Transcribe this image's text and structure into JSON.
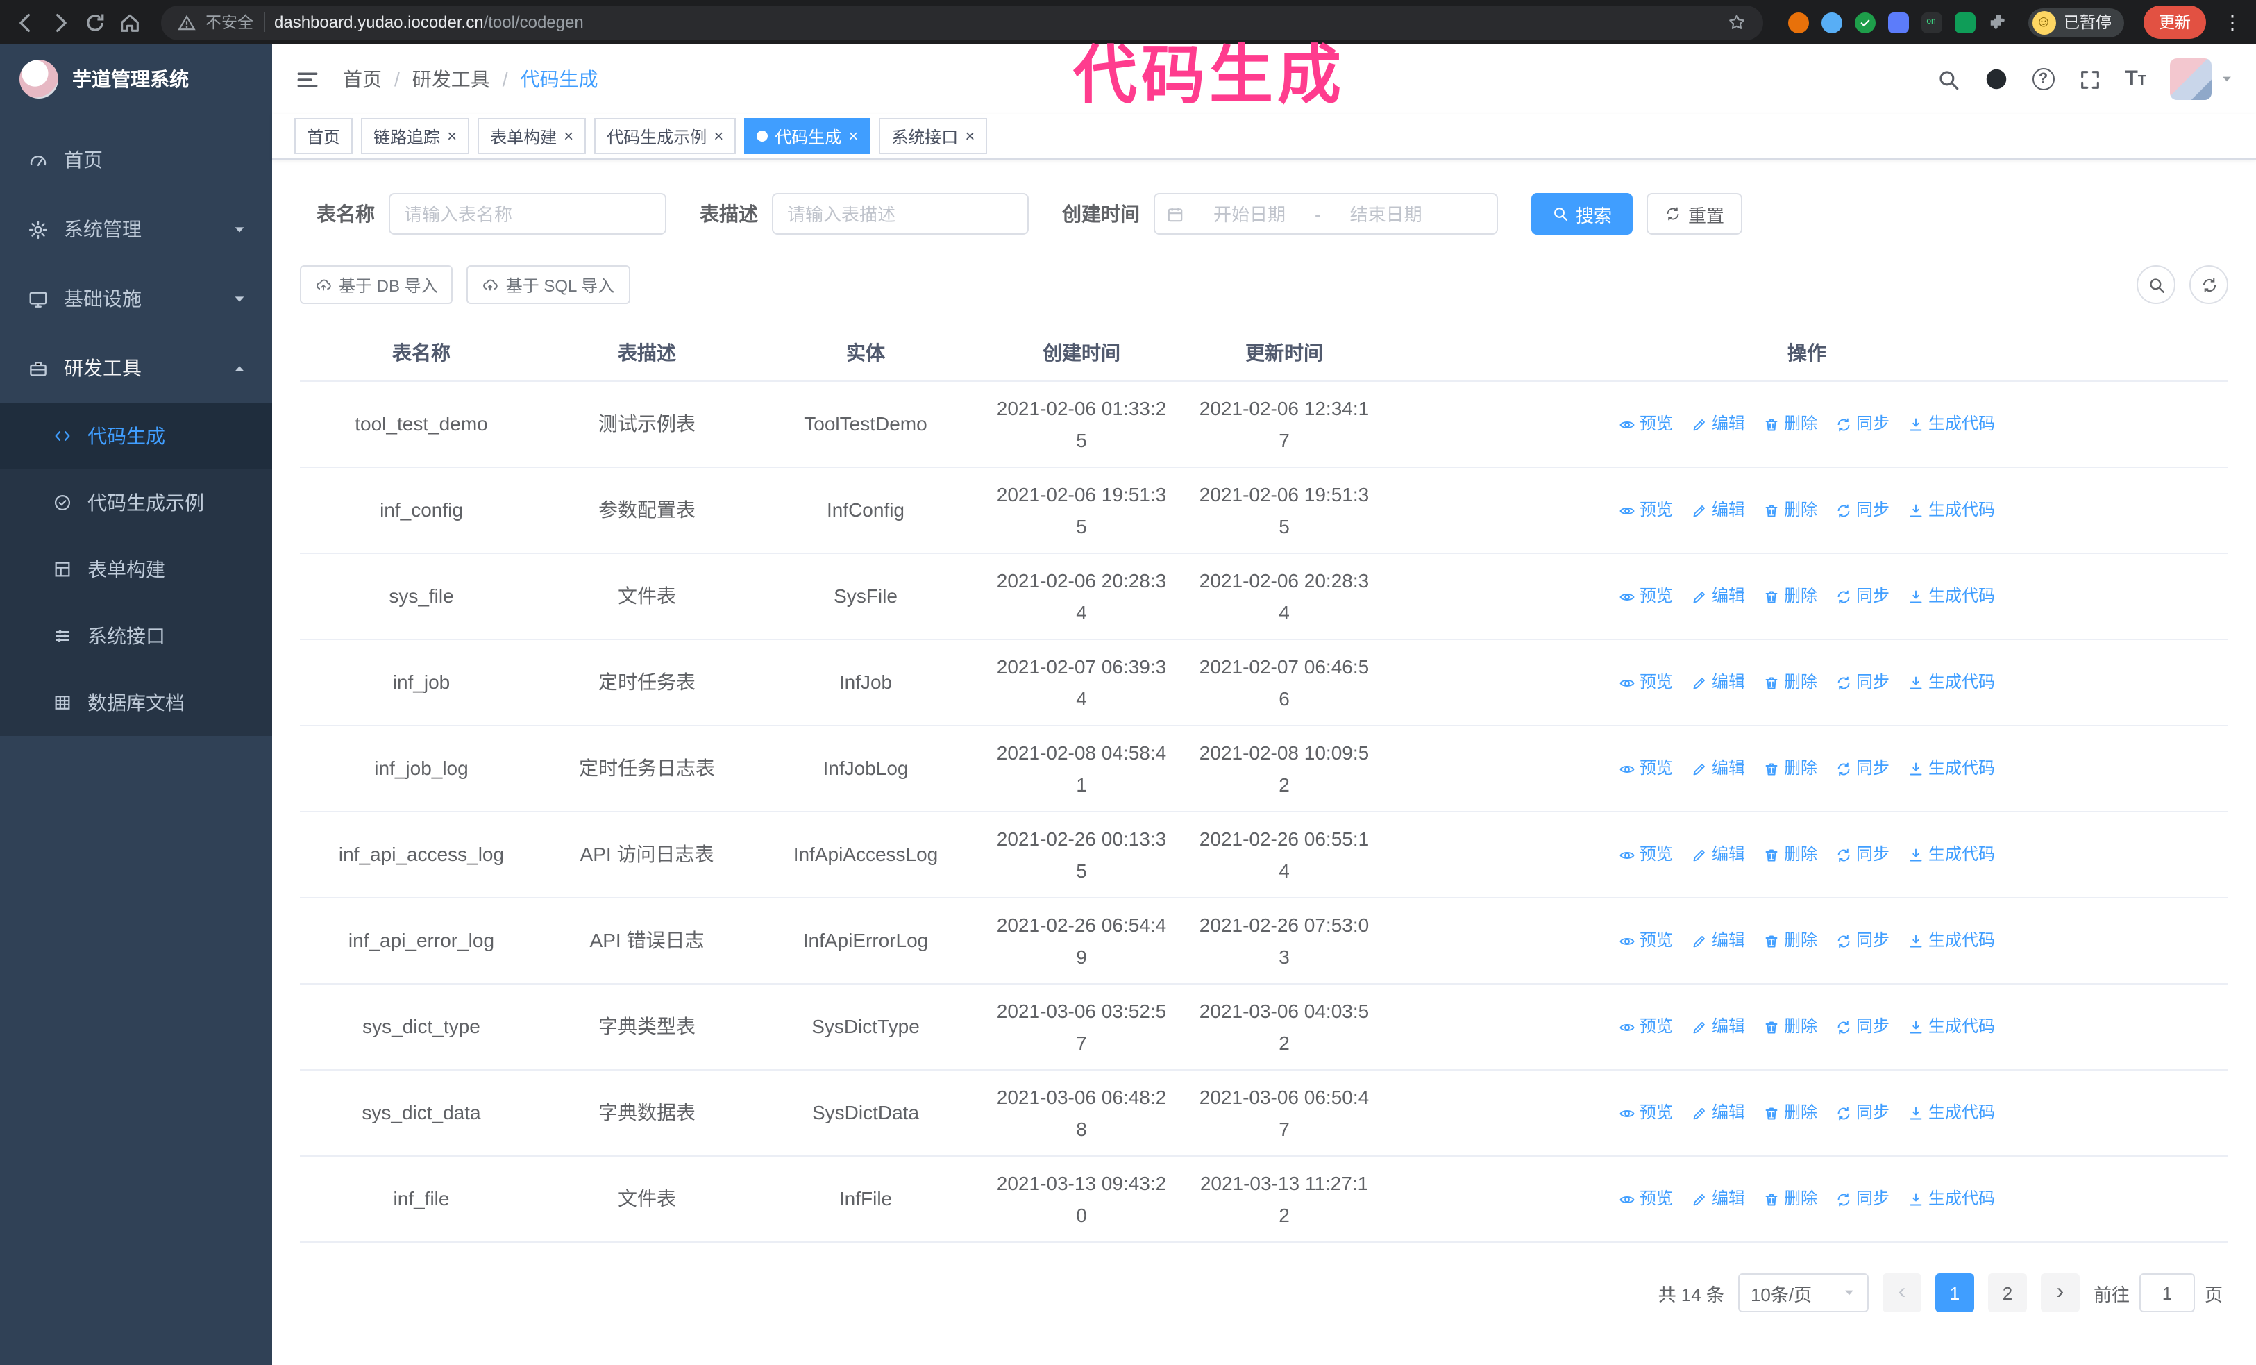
{
  "browser": {
    "security_label": "不安全",
    "url_host": "dashboard.yudao.iocoder.cn",
    "url_path": "/tool/codegen",
    "profile_badge": "已暂停",
    "update_button": "更新"
  },
  "annotation": {
    "text": "代码生成",
    "color": "#ff3c8e"
  },
  "colors": {
    "accent": "#409eff",
    "sidebar_bg": "#304156",
    "active_menu_text": "#409eff"
  },
  "sidebar": {
    "app_title": "芋道管理系统",
    "items": [
      {
        "label": "首页",
        "icon": "gauge-icon"
      },
      {
        "label": "系统管理",
        "icon": "gear-icon"
      },
      {
        "label": "基础设施",
        "icon": "monitor-icon"
      },
      {
        "label": "研发工具",
        "icon": "tools-icon"
      }
    ],
    "subitems": [
      {
        "label": "代码生成",
        "icon": "code-icon"
      },
      {
        "label": "代码生成示例",
        "icon": "badge-check-icon"
      },
      {
        "label": "表单构建",
        "icon": "form-grid-icon"
      },
      {
        "label": "系统接口",
        "icon": "sliders-icon"
      },
      {
        "label": "数据库文档",
        "icon": "database-grid-icon"
      }
    ]
  },
  "breadcrumb": [
    "首页",
    "研发工具",
    "代码生成"
  ],
  "tabs": [
    {
      "label": "首页"
    },
    {
      "label": "链路追踪"
    },
    {
      "label": "表单构建"
    },
    {
      "label": "代码生成示例"
    },
    {
      "label": "代码生成"
    },
    {
      "label": "系统接口"
    }
  ],
  "filters": {
    "name_label": "表名称",
    "name_placeholder": "请输入表名称",
    "desc_label": "表描述",
    "desc_placeholder": "请输入表描述",
    "time_label": "创建时间",
    "start_placeholder": "开始日期",
    "range_separator": "-",
    "end_placeholder": "结束日期",
    "search_button": "搜索",
    "reset_button": "重置"
  },
  "toolbar": {
    "import_db": "基于 DB 导入",
    "import_sql": "基于 SQL 导入"
  },
  "table": {
    "columns": [
      "表名称",
      "表描述",
      "实体",
      "创建时间",
      "更新时间",
      "操作"
    ],
    "actions": [
      "预览",
      "编辑",
      "删除",
      "同步",
      "生成代码"
    ],
    "rows": [
      {
        "name": "tool_test_demo",
        "desc": "测试示例表",
        "entity": "ToolTestDemo",
        "created": "2021-02-06 01:33:25",
        "updated": "2021-02-06 12:34:17"
      },
      {
        "name": "inf_config",
        "desc": "参数配置表",
        "entity": "InfConfig",
        "created": "2021-02-06 19:51:35",
        "updated": "2021-02-06 19:51:35"
      },
      {
        "name": "sys_file",
        "desc": "文件表",
        "entity": "SysFile",
        "created": "2021-02-06 20:28:34",
        "updated": "2021-02-06 20:28:34"
      },
      {
        "name": "inf_job",
        "desc": "定时任务表",
        "entity": "InfJob",
        "created": "2021-02-07 06:39:34",
        "updated": "2021-02-07 06:46:56"
      },
      {
        "name": "inf_job_log",
        "desc": "定时任务日志表",
        "entity": "InfJobLog",
        "created": "2021-02-08 04:58:41",
        "updated": "2021-02-08 10:09:52"
      },
      {
        "name": "inf_api_access_log",
        "desc": "API 访问日志表",
        "entity": "InfApiAccessLog",
        "created": "2021-02-26 00:13:35",
        "updated": "2021-02-26 06:55:14"
      },
      {
        "name": "inf_api_error_log",
        "desc": "API 错误日志",
        "entity": "InfApiErrorLog",
        "created": "2021-02-26 06:54:49",
        "updated": "2021-02-26 07:53:03"
      },
      {
        "name": "sys_dict_type",
        "desc": "字典类型表",
        "entity": "SysDictType",
        "created": "2021-03-06 03:52:57",
        "updated": "2021-03-06 04:03:52"
      },
      {
        "name": "sys_dict_data",
        "desc": "字典数据表",
        "entity": "SysDictData",
        "created": "2021-03-06 06:48:28",
        "updated": "2021-03-06 06:50:47"
      },
      {
        "name": "inf_file",
        "desc": "文件表",
        "entity": "InfFile",
        "created": "2021-03-13 09:43:20",
        "updated": "2021-03-13 11:27:12"
      }
    ]
  },
  "pagination": {
    "total": "共 14 条",
    "page_size": "10条/页",
    "page1": "1",
    "page2": "2",
    "goto_label": "前往",
    "goto_value": "1",
    "goto_suffix": "页"
  }
}
